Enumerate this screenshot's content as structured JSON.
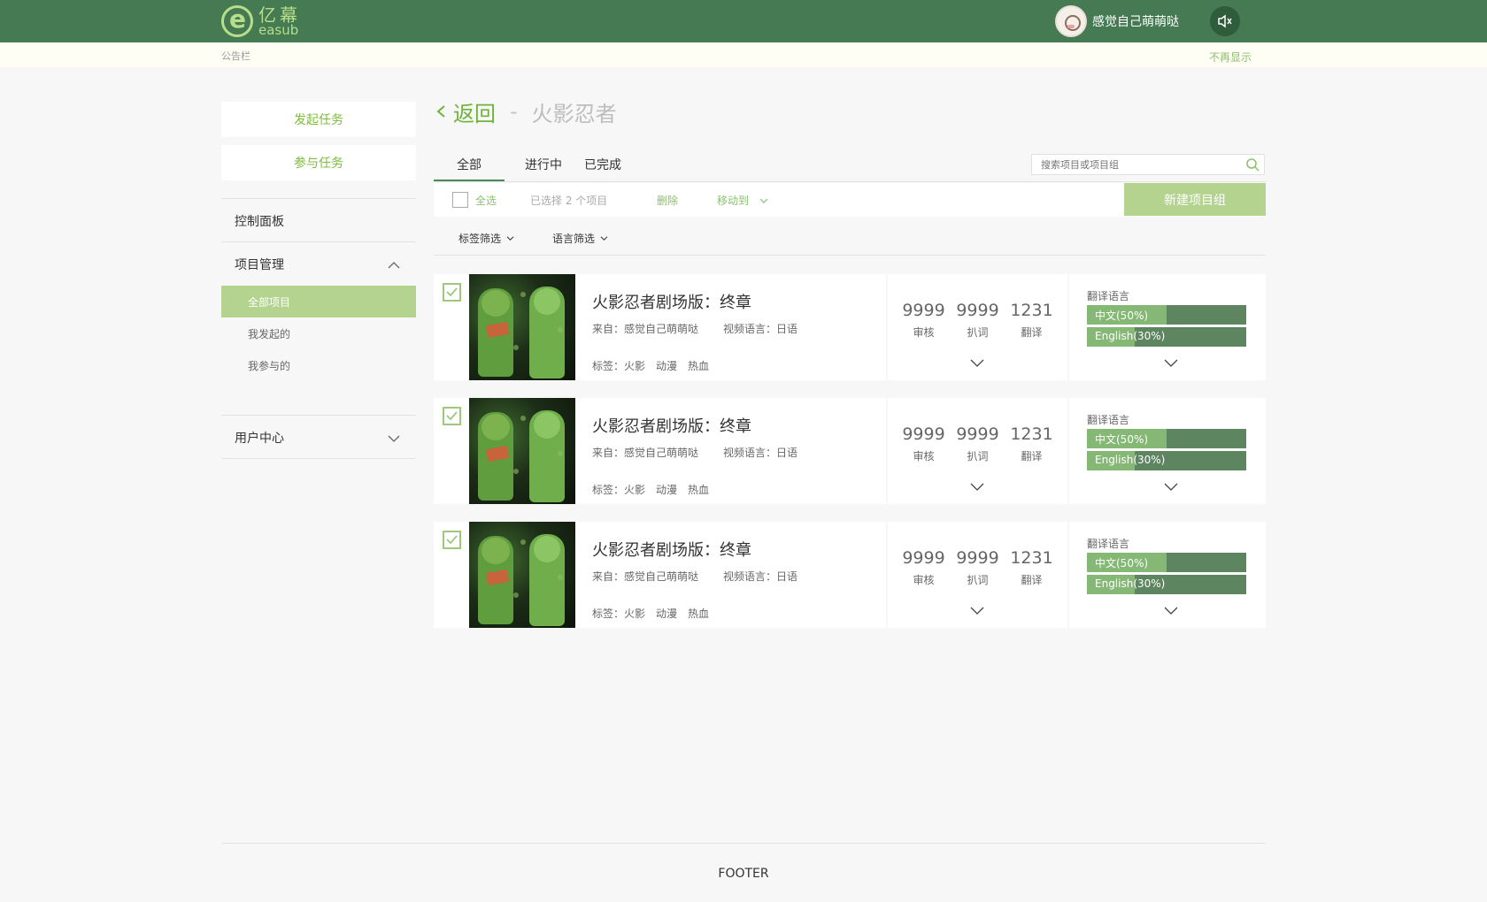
{
  "brand": {
    "cn": "亿幕",
    "en": "easub"
  },
  "user": {
    "name": "感觉自己萌萌哒"
  },
  "notice": {
    "label": "公告栏",
    "hide": "不再显示"
  },
  "sidebar": {
    "start_task": "发起任务",
    "join_task": "参与任务",
    "dashboard": "控制面板",
    "project_mgmt": "项目管理",
    "sub_items": [
      "全部项目",
      "我发起的",
      "我参与的"
    ],
    "user_center": "用户中心"
  },
  "breadcrumb": {
    "back": "返回",
    "sep": "-",
    "title": "火影忍者"
  },
  "tabs": [
    "全部",
    "进行中",
    "已完成"
  ],
  "search": {
    "placeholder": "搜索项目或项目组"
  },
  "toolbar": {
    "select_all": "全选",
    "selected": "已选择 2 个项目",
    "delete": "删除",
    "move_to": "移动到",
    "new_group": "新建项目组"
  },
  "filters": {
    "tag": "标签筛选",
    "language": "语言筛选"
  },
  "projects": [
    {
      "title": "火影忍者剧场版：终章",
      "from": "来自：感觉自己萌萌哒",
      "video_lang": "视频语言：日语",
      "tags_label": "标签：火影",
      "tags": [
        "动漫",
        "热血"
      ],
      "stats": [
        {
          "num": "9999",
          "label": "审核"
        },
        {
          "num": "9999",
          "label": "扒词"
        },
        {
          "num": "1231",
          "label": "翻译"
        }
      ],
      "lang_title": "翻译语言",
      "langs": [
        {
          "label": "中文(50%)",
          "progress": 0.5
        },
        {
          "label": "English(30%)",
          "progress": 0.3
        }
      ]
    },
    {
      "title": "火影忍者剧场版：终章",
      "from": "来自：感觉自己萌萌哒",
      "video_lang": "视频语言：日语",
      "tags_label": "标签：火影",
      "tags": [
        "动漫",
        "热血"
      ],
      "stats": [
        {
          "num": "9999",
          "label": "审核"
        },
        {
          "num": "9999",
          "label": "扒词"
        },
        {
          "num": "1231",
          "label": "翻译"
        }
      ],
      "lang_title": "翻译语言",
      "langs": [
        {
          "label": "中文(50%)",
          "progress": 0.5
        },
        {
          "label": "English(30%)",
          "progress": 0.3
        }
      ]
    },
    {
      "title": "火影忍者剧场版：终章",
      "from": "来自：感觉自己萌萌哒",
      "video_lang": "视频语言：日语",
      "tags_label": "标签：火影",
      "tags": [
        "动漫",
        "热血"
      ],
      "stats": [
        {
          "num": "9999",
          "label": "审核"
        },
        {
          "num": "9999",
          "label": "扒词"
        },
        {
          "num": "1231",
          "label": "翻译"
        }
      ],
      "lang_title": "翻译语言",
      "langs": [
        {
          "label": "中文(50%)",
          "progress": 0.5
        },
        {
          "label": "English(30%)",
          "progress": 0.3
        }
      ]
    }
  ],
  "footer": "FOOTER",
  "colors": {
    "header": "#457a52",
    "accent": "#7cbd3a",
    "active_bg": "#b3d38f"
  }
}
